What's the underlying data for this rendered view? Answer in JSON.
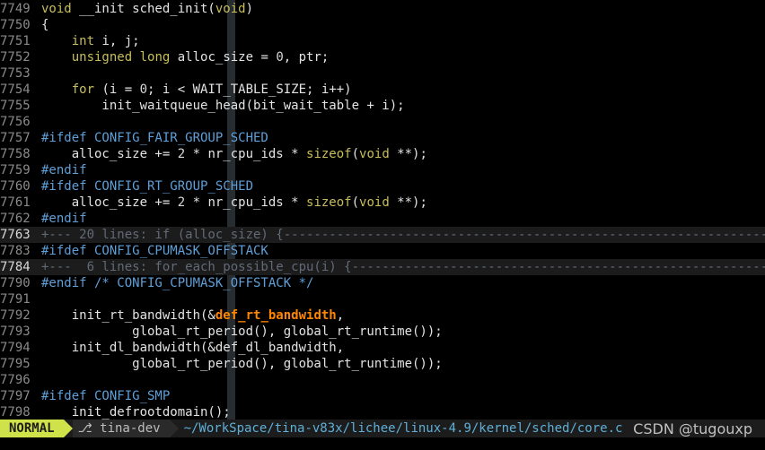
{
  "editor": {
    "lines": [
      {
        "n": "7749",
        "cur": false,
        "fold": false,
        "parts": [
          [
            "t-type",
            "void"
          ],
          [
            "t-plain",
            " __init sched_init("
          ],
          [
            "t-type",
            "void"
          ],
          [
            "t-plain",
            ")"
          ]
        ]
      },
      {
        "n": "7750",
        "cur": false,
        "fold": false,
        "parts": [
          [
            "t-plain",
            "{"
          ]
        ]
      },
      {
        "n": "7751",
        "cur": false,
        "fold": false,
        "parts": [
          [
            "t-plain",
            "    "
          ],
          [
            "t-type",
            "int"
          ],
          [
            "t-plain",
            " i, j;"
          ]
        ]
      },
      {
        "n": "7752",
        "cur": false,
        "fold": false,
        "parts": [
          [
            "t-plain",
            "    "
          ],
          [
            "t-type",
            "unsigned"
          ],
          [
            "t-plain",
            " "
          ],
          [
            "t-type",
            "long"
          ],
          [
            "t-plain",
            " alloc_size = "
          ],
          [
            "t-num",
            "0"
          ],
          [
            "t-plain",
            ", ptr;"
          ]
        ]
      },
      {
        "n": "7753",
        "cur": false,
        "fold": false,
        "parts": []
      },
      {
        "n": "7754",
        "cur": false,
        "fold": false,
        "parts": [
          [
            "t-plain",
            "    "
          ],
          [
            "t-kw",
            "for"
          ],
          [
            "t-plain",
            " (i = "
          ],
          [
            "t-num",
            "0"
          ],
          [
            "t-plain",
            "; i < WAIT_TABLE_SIZE; i++)"
          ]
        ]
      },
      {
        "n": "7755",
        "cur": false,
        "fold": false,
        "parts": [
          [
            "t-plain",
            "        init_waitqueue_head(bit_wait_table + i);"
          ]
        ]
      },
      {
        "n": "7756",
        "cur": false,
        "fold": false,
        "parts": []
      },
      {
        "n": "7757",
        "cur": false,
        "fold": false,
        "parts": [
          [
            "t-pre",
            "#ifdef CONFIG_FAIR_GROUP_SCHED"
          ]
        ]
      },
      {
        "n": "7758",
        "cur": false,
        "fold": false,
        "parts": [
          [
            "t-plain",
            "    alloc_size += "
          ],
          [
            "t-num",
            "2"
          ],
          [
            "t-plain",
            " * nr_cpu_ids * "
          ],
          [
            "t-kw",
            "sizeof"
          ],
          [
            "t-plain",
            "("
          ],
          [
            "t-type",
            "void"
          ],
          [
            "t-plain",
            " **);"
          ]
        ]
      },
      {
        "n": "7759",
        "cur": false,
        "fold": false,
        "parts": [
          [
            "t-pre",
            "#endif"
          ]
        ]
      },
      {
        "n": "7760",
        "cur": false,
        "fold": false,
        "parts": [
          [
            "t-pre",
            "#ifdef CONFIG_RT_GROUP_SCHED"
          ]
        ]
      },
      {
        "n": "7761",
        "cur": false,
        "fold": false,
        "parts": [
          [
            "t-plain",
            "    alloc_size += "
          ],
          [
            "t-num",
            "2"
          ],
          [
            "t-plain",
            " * nr_cpu_ids * "
          ],
          [
            "t-kw",
            "sizeof"
          ],
          [
            "t-plain",
            "("
          ],
          [
            "t-type",
            "void"
          ],
          [
            "t-plain",
            " **);"
          ]
        ]
      },
      {
        "n": "7762",
        "cur": false,
        "fold": false,
        "parts": [
          [
            "t-pre",
            "#endif"
          ]
        ]
      },
      {
        "n": "7763",
        "cur": true,
        "fold": true,
        "parts": [
          [
            "t-fold",
            "+--- 20 lines: if (alloc_size) {---------------------------------------------------------------------------"
          ]
        ]
      },
      {
        "n": "7783",
        "cur": false,
        "fold": false,
        "parts": [
          [
            "t-pre",
            "#ifdef CONFIG_CPUMASK_OFFSTACK"
          ]
        ]
      },
      {
        "n": "7784",
        "cur": true,
        "fold": true,
        "parts": [
          [
            "t-fold",
            "+---  6 lines: for_each_possible_cpu(i) {------------------------------------------------------------------"
          ]
        ]
      },
      {
        "n": "7790",
        "cur": false,
        "fold": false,
        "parts": [
          [
            "t-pre",
            "#endif /* CONFIG_CPUMASK_OFFSTACK */"
          ]
        ]
      },
      {
        "n": "7791",
        "cur": false,
        "fold": false,
        "parts": []
      },
      {
        "n": "7792",
        "cur": false,
        "fold": false,
        "parts": [
          [
            "t-plain",
            "    init_rt_bandwidth(&"
          ],
          [
            "t-hl",
            "def_rt_bandwidth"
          ],
          [
            "t-plain",
            ","
          ]
        ]
      },
      {
        "n": "7793",
        "cur": false,
        "fold": false,
        "parts": [
          [
            "t-plain",
            "            global_rt_period(), global_rt_runtime());"
          ]
        ]
      },
      {
        "n": "7794",
        "cur": false,
        "fold": false,
        "parts": [
          [
            "t-plain",
            "    init_dl_bandwidth(&def_dl_bandwidth,"
          ]
        ]
      },
      {
        "n": "7795",
        "cur": false,
        "fold": false,
        "parts": [
          [
            "t-plain",
            "            global_rt_period(), global_rt_runtime());"
          ]
        ]
      },
      {
        "n": "7796",
        "cur": false,
        "fold": false,
        "parts": []
      },
      {
        "n": "7797",
        "cur": false,
        "fold": false,
        "parts": [
          [
            "t-pre",
            "#ifdef CONFIG_SMP"
          ]
        ]
      },
      {
        "n": "7798",
        "cur": false,
        "fold": false,
        "parts": [
          [
            "t-plain",
            "    init_defrootdomain();"
          ]
        ]
      }
    ]
  },
  "statusbar": {
    "mode": "NORMAL",
    "branch": "⎇ tina-dev",
    "path": "~/WorkSpace/tina-v83x/lichee/linux-4.9/kernel/sched/core.c"
  },
  "watermark": "CSDN @tugouxp",
  "colors": {
    "background": "#000000",
    "mode_bg": "#cfe24a",
    "keyword": "#c8be5a",
    "preprocessor": "#5f9fd8",
    "highlight": "#ff8700",
    "fold_text": "#626a78",
    "path": "#5fafd7"
  }
}
